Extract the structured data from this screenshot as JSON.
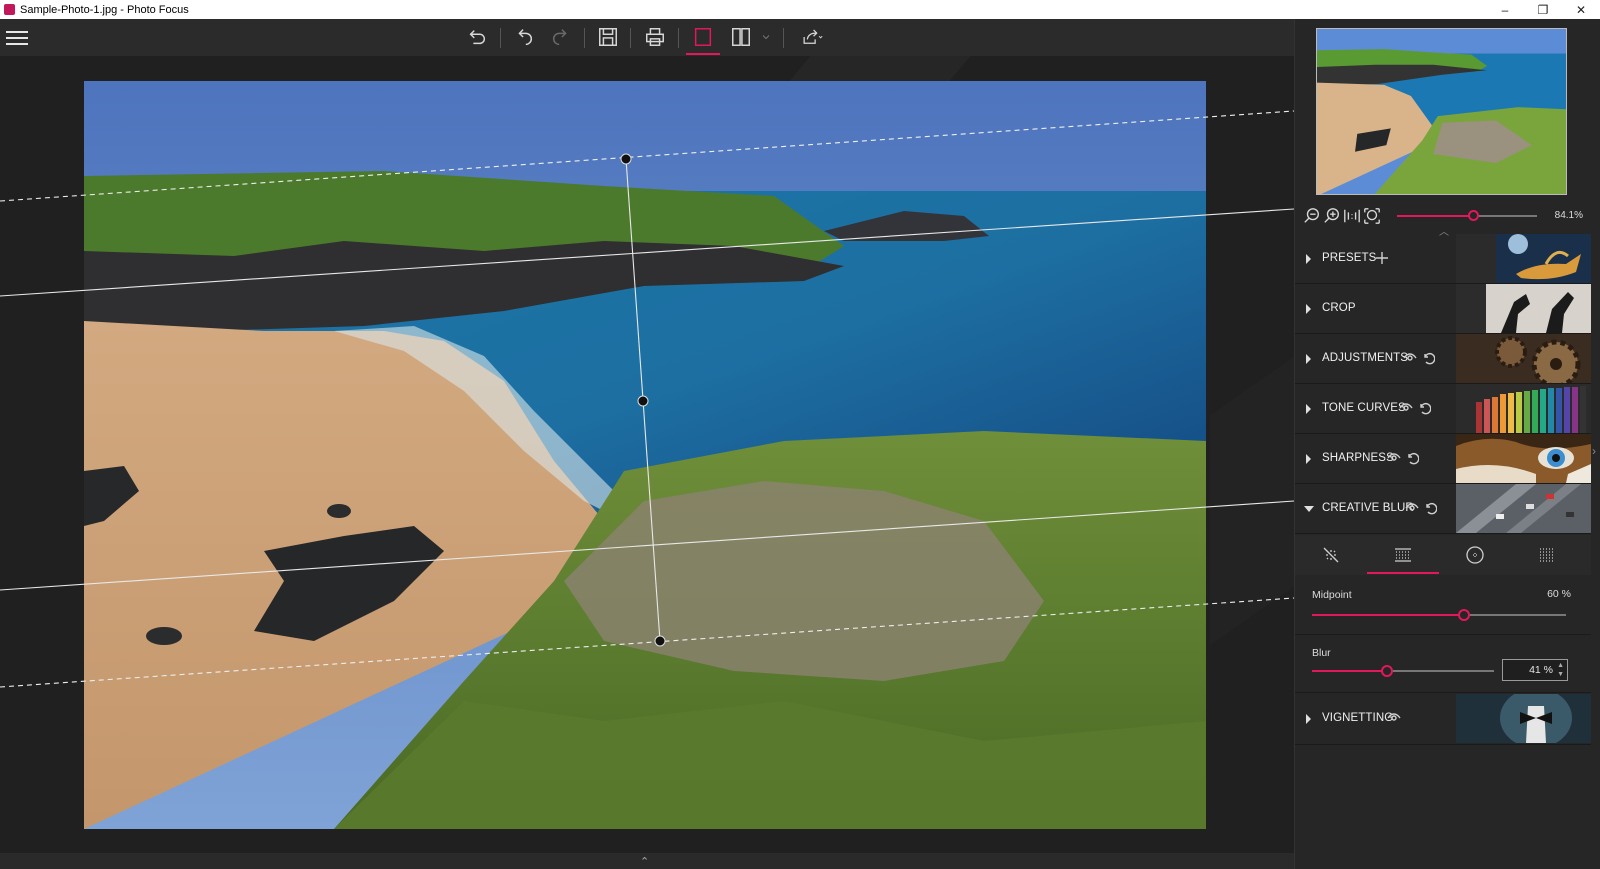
{
  "window": {
    "title": "Sample-Photo-1.jpg - Photo Focus",
    "controls": [
      "–",
      "❐",
      "✕"
    ]
  },
  "toolbar": {
    "icons": [
      "menu-icon",
      "undo-all-icon",
      "undo-icon",
      "redo-icon",
      "save-icon",
      "print-icon",
      "single-view-icon",
      "split-view-icon",
      "chevron-down-icon",
      "share-icon"
    ],
    "active": "single-view-icon",
    "accent": "#e2185b"
  },
  "navigator": {
    "zoom_percent": "84.1%",
    "zoom_level": 0.55
  },
  "panel": {
    "sections": [
      {
        "label": "PRESETS",
        "has_add": true,
        "image": "genie-lamp"
      },
      {
        "label": "CROP",
        "image": "hands-frame"
      },
      {
        "label": "ADJUSTMENTS",
        "has_eye": true,
        "has_reset": true,
        "image": "gears"
      },
      {
        "label": "TONE CURVES",
        "has_eye": true,
        "has_reset": true,
        "image": "colored-pencils"
      },
      {
        "label": "SHARPNESS",
        "has_eye": true,
        "has_reset": true,
        "image": "tiger-eye"
      },
      {
        "label": "CREATIVE BLUR",
        "has_eye": true,
        "has_reset": true,
        "expanded": true,
        "image": "street-aerial"
      },
      {
        "label": "VIGNETTING",
        "has_eye": true,
        "image": "bow-tie"
      }
    ],
    "blur_tabs": [
      "no-blur-icon",
      "linear-blur-icon",
      "radial-blur-icon",
      "grid-blur-icon"
    ],
    "active_blur_tab": "linear-blur-icon",
    "midpoint": {
      "label": "Midpoint",
      "value": "60 %",
      "level": 0.6
    },
    "blur": {
      "label": "Blur",
      "value": "41 %",
      "level": 0.41
    }
  },
  "bottom": {
    "chevron": "⌃"
  }
}
